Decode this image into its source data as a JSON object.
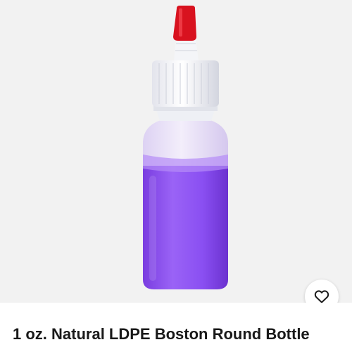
{
  "product": {
    "title": "1 oz. Natural LDPE Boston Round Bottle",
    "image_description_icon": "dropper-bottle-image"
  },
  "favorite": {
    "icon": "heart-outline-icon"
  },
  "colors": {
    "image_background": "#f2f2f2",
    "liquid": "#8a4ff2",
    "cap_tip": "#d8121f",
    "title_text": "#191919"
  }
}
